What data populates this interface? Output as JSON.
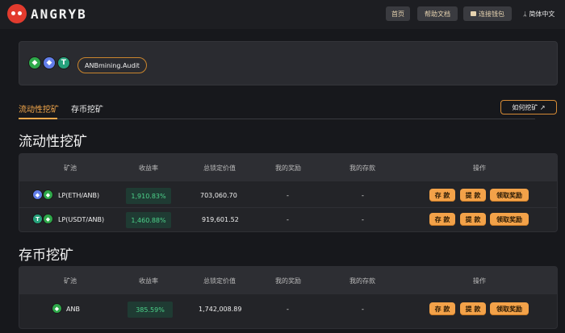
{
  "header": {
    "brand": "ANGRYB",
    "nav": {
      "home": "首页",
      "docs": "帮助文档",
      "wallet": "连接钱包"
    },
    "lang": "ᛦ 简体中文"
  },
  "audit": {
    "coins": [
      "ANB",
      "ETH",
      "USDT"
    ],
    "badge": "ANBmining.Audit"
  },
  "tabs": {
    "liquidity": "流动性挖矿",
    "deposit": "存币挖矿",
    "how": "如何挖矿 ↗"
  },
  "columns": {
    "pool": "矿池",
    "apy": "收益率",
    "tvl": "总锁定价值",
    "reward": "我的奖励",
    "deposit": "我的存款",
    "action": "操作"
  },
  "actions": {
    "deposit": "存 款",
    "withdraw": "提 款",
    "claim": "领取奖励"
  },
  "liquidity": {
    "title": "流动性挖矿",
    "rows": [
      {
        "icons": [
          "ETH",
          "ANB"
        ],
        "pool": "LP(ETH/ANB)",
        "apy": "1,910.83%",
        "tvl": "703,060.70",
        "reward": "-",
        "deposit": "-"
      },
      {
        "icons": [
          "USDT",
          "ANB"
        ],
        "pool": "LP(USDT/ANB)",
        "apy": "1,460.88%",
        "tvl": "919,601.52",
        "reward": "-",
        "deposit": "-"
      }
    ]
  },
  "staking": {
    "title": "存币挖矿",
    "rows": [
      {
        "icons": [
          "ANB"
        ],
        "pool": "ANB",
        "apy": "385.59%",
        "tvl": "1,742,008.89",
        "reward": "-",
        "deposit": "-"
      }
    ]
  },
  "colors": {
    "accent": "#f3a249",
    "rate_text": "#4dd28a",
    "background": "#17181c"
  }
}
